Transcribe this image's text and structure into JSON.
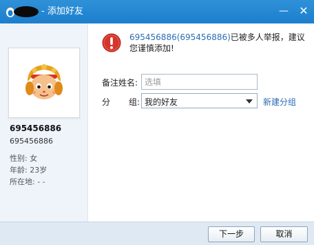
{
  "titlebar": {
    "title": "- 添加好友",
    "minimize_glyph": "—",
    "close_glyph": "✕"
  },
  "profile": {
    "nickname": "695456886",
    "qq_number": "695456886",
    "gender": "性别: 女",
    "age": "年龄: 23岁",
    "location": "所在地: -  -"
  },
  "warning": {
    "number_text": "695456886(695456886)",
    "message": "已被多人举报，建议您谨慎添加!"
  },
  "form": {
    "remark_label": "备注姓名:",
    "remark_value": "",
    "remark_placeholder": "选填",
    "group_label_left": "分",
    "group_label_right": "组:",
    "group_selected": "我的好友",
    "new_group_link": "新建分组"
  },
  "buttons": {
    "next": "下一步",
    "cancel": "取消"
  },
  "colors": {
    "titlebar": "#1d7fcd",
    "link": "#2b6bb5",
    "warning_red": "#d6352b",
    "sidebar_bg": "#eef4fa"
  },
  "icons": {
    "app": "qq-penguin-icon",
    "warning": "exclamation-circle-icon",
    "avatar": "monkey-king-avatar"
  }
}
